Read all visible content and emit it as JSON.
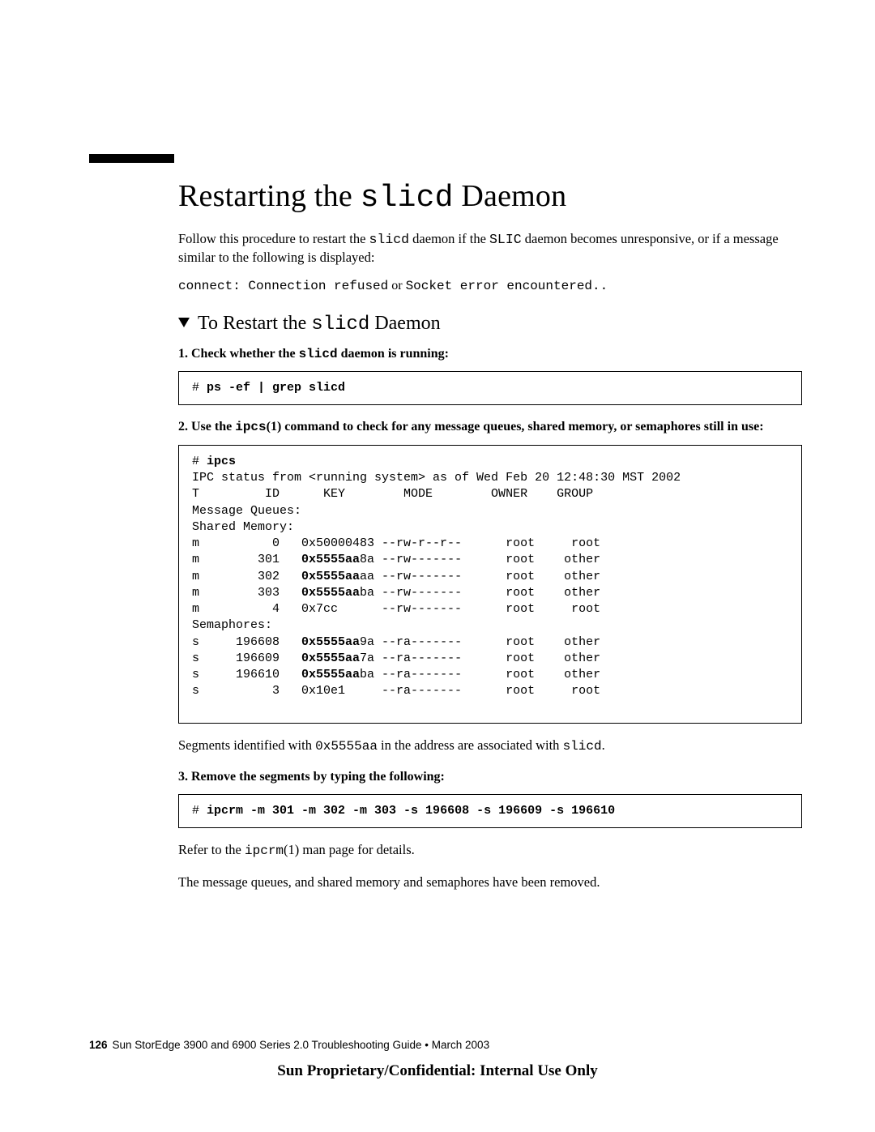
{
  "title_pre": "Restarting the ",
  "title_mono": "slicd",
  "title_post": " Daemon",
  "intro_a": "Follow this procedure to restart the ",
  "intro_mono1": "slicd",
  "intro_b": " daemon if the ",
  "intro_mono2": "SLIC",
  "intro_c": " daemon becomes unresponsive, or if a message similar to the following is displayed:",
  "connect_a": "connect: Connection refused",
  "connect_or": " or ",
  "connect_b": "Socket error encountered..",
  "sub_pre": "To Restart the ",
  "sub_mono": "slicd",
  "sub_post": " Daemon",
  "step1_a": "Check whether the ",
  "step1_mono": "slicd",
  "step1_b": " daemon is running:",
  "code1_prompt": "# ",
  "code1_cmd": "ps -ef | grep slicd",
  "step2_a": "Use the ",
  "step2_mono": "ipcs",
  "step2_paren": "(1)",
  "step2_b": " command to check for any message queues, shared memory, or semaphores still in use:",
  "code2_prompt": "# ",
  "code2_cmd": "ipcs",
  "code2_header": "IPC status from <running system> as of Wed Feb 20 12:48:30 MST 2002",
  "code2_cols": "T         ID      KEY        MODE        OWNER    GROUP",
  "code2_mq": "Message Queues:",
  "code2_sm": "Shared Memory:",
  "sm0": "m          0   0x50000483 --rw-r--r--      root     root",
  "sm1_a": "m        301   ",
  "sm1_k": "0x5555aa",
  "sm1_b": "8a --rw-------      root    other",
  "sm2_a": "m        302   ",
  "sm2_k": "0x5555aa",
  "sm2_b": "aa --rw-------      root    other",
  "sm3_a": "m        303   ",
  "sm3_k": "0x5555aa",
  "sm3_b": "ba --rw-------      root    other",
  "sm4": "m          4   0x7cc      --rw-------      root     root",
  "code2_se": "Semaphores:",
  "se1_a": "s     196608   ",
  "se1_k": "0x5555aa",
  "se1_b": "9a --ra-------      root    other",
  "se2_a": "s     196609   ",
  "se2_k": "0x5555aa",
  "se2_b": "7a --ra-------      root    other",
  "se3_a": "s     196610   ",
  "se3_k": "0x5555aa",
  "se3_b": "ba --ra-------      root    other",
  "se4": "s          3   0x10e1     --ra-------      root     root",
  "segnote_a": "Segments identified with ",
  "segnote_mono": "0x5555aa",
  "segnote_b": " in the address are associated with ",
  "segnote_mono2": "slicd",
  "segnote_c": ".",
  "step3": "Remove the segments by typing the following:",
  "code3_prompt": "# ",
  "code3_cmd": "ipcrm -m 301 -m 302 -m 303 -s 196608 -s 196609 -s 196610",
  "refer_a": "Refer to the ",
  "refer_mono": "ipcrm",
  "refer_b": "(1) man page for details.",
  "removed": "The message queues, and shared memory and semaphores have been removed.",
  "page_num": "126",
  "footer_text": "Sun StorEdge 3900 and 6900 Series 2.0 Troubleshooting Guide • March 2003",
  "confidential": "Sun Proprietary/Confidential: Internal Use Only"
}
